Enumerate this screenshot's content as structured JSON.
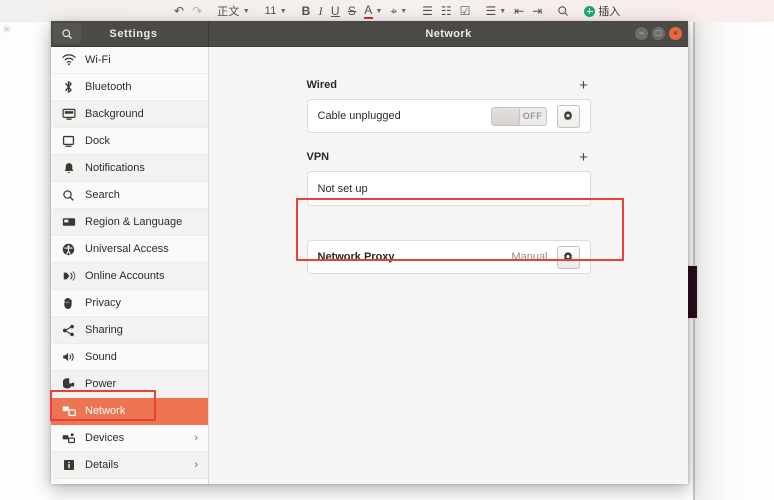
{
  "background_doc": {
    "toolbar": [
      {
        "name": "undo-icon",
        "glyph": "↶",
        "type": "icon",
        "dim": false
      },
      {
        "name": "redo-icon",
        "glyph": "↷",
        "type": "icon",
        "dim": true
      },
      {
        "name": "paragraph-style-select",
        "glyph": "正文",
        "type": "text",
        "caret": true
      },
      {
        "name": "font-size-select",
        "glyph": "11",
        "type": "text",
        "caret": true
      },
      {
        "name": "bold-icon",
        "glyph": "B",
        "type": "text",
        "dim": false
      },
      {
        "name": "italic-icon",
        "glyph": "I",
        "type": "text",
        "dim": false
      },
      {
        "name": "underline-icon",
        "glyph": "U",
        "type": "text",
        "dim": false
      },
      {
        "name": "strikethrough-icon",
        "glyph": "S",
        "type": "text",
        "dim": false
      },
      {
        "name": "font-color-icon",
        "glyph": "A",
        "type": "text",
        "caret": true
      },
      {
        "name": "highlight-color-icon",
        "glyph": "⌖",
        "type": "icon",
        "caret": true
      },
      {
        "name": "bullet-list-icon",
        "glyph": "☰",
        "type": "icon"
      },
      {
        "name": "numbered-list-icon",
        "glyph": "☷",
        "type": "icon"
      },
      {
        "name": "checkbox-list-icon",
        "glyph": "☑",
        "type": "icon"
      },
      {
        "name": "align-icon",
        "glyph": "☰",
        "type": "icon",
        "caret": true
      },
      {
        "name": "decrease-indent-icon",
        "glyph": "⇤",
        "type": "icon"
      },
      {
        "name": "increase-indent-icon",
        "glyph": "⇥",
        "type": "icon"
      },
      {
        "name": "search-icon",
        "glyph": "🔍",
        "type": "icon"
      }
    ],
    "insert_label": "插入",
    "page_glyph": "⦀"
  },
  "window": {
    "sidebar_title": "Settings",
    "content_title": "Network",
    "search_icon": "search-icon",
    "controls": [
      {
        "name": "minimize-button",
        "glyph": "−"
      },
      {
        "name": "maximize-button",
        "glyph": "□"
      },
      {
        "name": "close-button",
        "glyph": "×"
      }
    ]
  },
  "sidebar": {
    "items": [
      {
        "label": "Wi-Fi",
        "icon": "wifi-icon",
        "active": false,
        "chevron": false
      },
      {
        "label": "Bluetooth",
        "icon": "bluetooth-icon",
        "active": false,
        "chevron": false
      },
      {
        "label": "Background",
        "icon": "background-icon",
        "active": false,
        "chevron": false
      },
      {
        "label": "Dock",
        "icon": "dock-icon",
        "active": false,
        "chevron": false
      },
      {
        "label": "Notifications",
        "icon": "bell-icon",
        "active": false,
        "chevron": false
      },
      {
        "label": "Search",
        "icon": "search-icon",
        "active": false,
        "chevron": false
      },
      {
        "label": "Region & Language",
        "icon": "region-language-icon",
        "active": false,
        "chevron": false
      },
      {
        "label": "Universal Access",
        "icon": "universal-access-icon",
        "active": false,
        "chevron": false
      },
      {
        "label": "Online Accounts",
        "icon": "online-accounts-icon",
        "active": false,
        "chevron": false
      },
      {
        "label": "Privacy",
        "icon": "privacy-hand-icon",
        "active": false,
        "chevron": false
      },
      {
        "label": "Sharing",
        "icon": "sharing-icon",
        "active": false,
        "chevron": false
      },
      {
        "label": "Sound",
        "icon": "speaker-icon",
        "active": false,
        "chevron": false
      },
      {
        "label": "Power",
        "icon": "power-battery-icon",
        "active": false,
        "chevron": false
      },
      {
        "label": "Network",
        "icon": "network-icon",
        "active": true,
        "chevron": false
      },
      {
        "label": "Devices",
        "icon": "devices-icon",
        "active": false,
        "chevron": true
      },
      {
        "label": "Details",
        "icon": "details-icon",
        "active": false,
        "chevron": true
      }
    ],
    "chevron_glyph": "›"
  },
  "content": {
    "sections": [
      {
        "title": "Wired",
        "add_label": "+",
        "row": {
          "label": "Cable unplugged",
          "bold": false,
          "toggle": {
            "state": "OFF",
            "on": false
          },
          "gear": true,
          "value": ""
        }
      },
      {
        "title": "VPN",
        "add_label": "+",
        "row": {
          "label": "Not set up",
          "bold": false,
          "toggle": null,
          "gear": false,
          "value": ""
        }
      },
      {
        "title": "",
        "add_label": "",
        "row": {
          "label": "Network Proxy",
          "bold": true,
          "toggle": null,
          "gear": true,
          "value": "Manual"
        }
      }
    ]
  },
  "annotations": {
    "color": "#e8413a",
    "boxes": [
      {
        "name": "annotation-network-sidebar",
        "target": "Network"
      },
      {
        "name": "annotation-network-proxy",
        "target": "Network Proxy"
      }
    ]
  },
  "colors": {
    "accent": "#ed7551",
    "header_bg": "#4b4a46",
    "annotation": "#e8413a",
    "close_button": "#e8693c"
  }
}
